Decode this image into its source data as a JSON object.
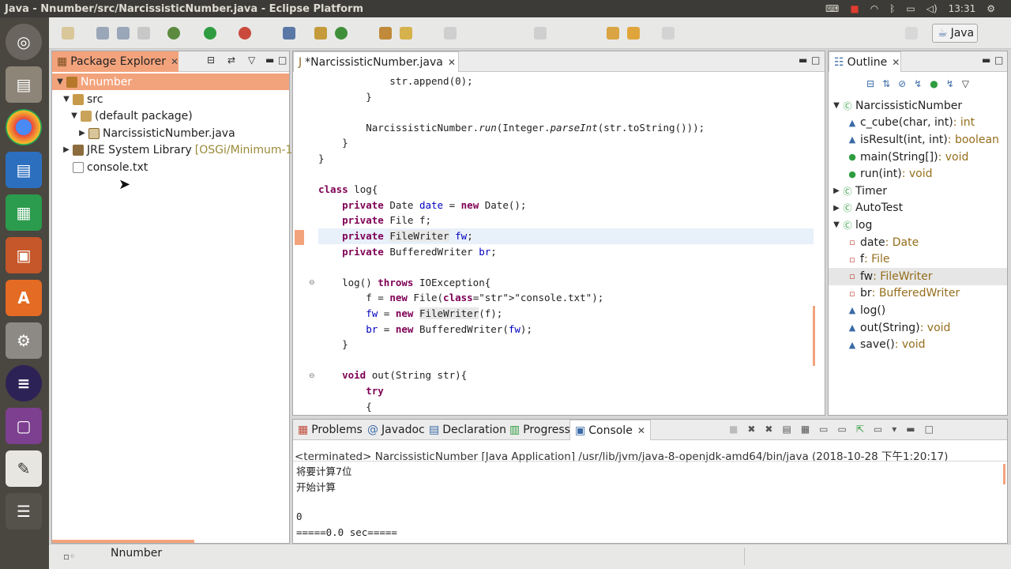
{
  "window": {
    "title": "Java - Nnumber/src/NarcissisticNumber.java - Eclipse Platform"
  },
  "tray": {
    "time": "13:31"
  },
  "toolbar": {
    "perspective": "Java"
  },
  "package_explorer": {
    "tab": "Package Explorer",
    "items": [
      {
        "label": "Nnumber",
        "type": "project"
      },
      {
        "label": "src",
        "type": "folder"
      },
      {
        "label": "(default package)",
        "type": "package"
      },
      {
        "label": "NarcissisticNumber.java",
        "type": "file"
      },
      {
        "label": "JRE System Library",
        "extra": "[OSGi/Minimum-1.2]",
        "type": "library"
      },
      {
        "label": "console.txt",
        "type": "text"
      }
    ]
  },
  "editor": {
    "tab": "*NarcissisticNumber.java",
    "lines": [
      "            str.append(0);",
      "        }",
      "",
      "        NarcissisticNumber.run(Integer.parseInt(str.toString()));",
      "    }",
      "}",
      "",
      "class log{",
      "    private Date date = new Date();",
      "    private File f;",
      "    private FileWriter fw;",
      "    private BufferedWriter br;",
      "",
      "    log() throws IOException{",
      "        f = new File(\"console.txt\");",
      "        fw = new FileWriter(f);",
      "        br = new BufferedWriter(fw);",
      "    }",
      "",
      "    void out(String str){",
      "        try",
      "        {"
    ]
  },
  "outline": {
    "tab": "Outline",
    "items": [
      {
        "name": "NarcissisticNumber",
        "type": ""
      },
      {
        "name": "c_cube(char, int)",
        "type": " : int"
      },
      {
        "name": "isResult(int, int)",
        "type": " : boolean"
      },
      {
        "name": "main(String[])",
        "type": " : void"
      },
      {
        "name": "run(int)",
        "type": " : void"
      },
      {
        "name": "Timer",
        "type": ""
      },
      {
        "name": "AutoTest",
        "type": ""
      },
      {
        "name": "log",
        "type": ""
      },
      {
        "name": "date",
        "type": " : Date"
      },
      {
        "name": "f",
        "type": " : File"
      },
      {
        "name": "fw",
        "type": " : FileWriter"
      },
      {
        "name": "br",
        "type": " : BufferedWriter"
      },
      {
        "name": "log()",
        "type": ""
      },
      {
        "name": "out(String)",
        "type": " : void"
      },
      {
        "name": "save()",
        "type": " : void"
      }
    ]
  },
  "bottom_tabs": [
    "Problems",
    "Javadoc",
    "Declaration",
    "Progress",
    "Console"
  ],
  "console": {
    "header": "<terminated> NarcissisticNumber [Java Application] /usr/lib/jvm/java-8-openjdk-amd64/bin/java (2018-10-28 下午1:20:17)",
    "lines": [
      "将要计算7位",
      "开始计算",
      "",
      "0",
      "=====0.0 sec====="
    ]
  },
  "status": {
    "selection": "Nnumber"
  },
  "colors": {
    "active_tab": "#f3a37c",
    "keyword": "#7f0055",
    "string": "#2a00ff",
    "field": "#0000c0"
  }
}
